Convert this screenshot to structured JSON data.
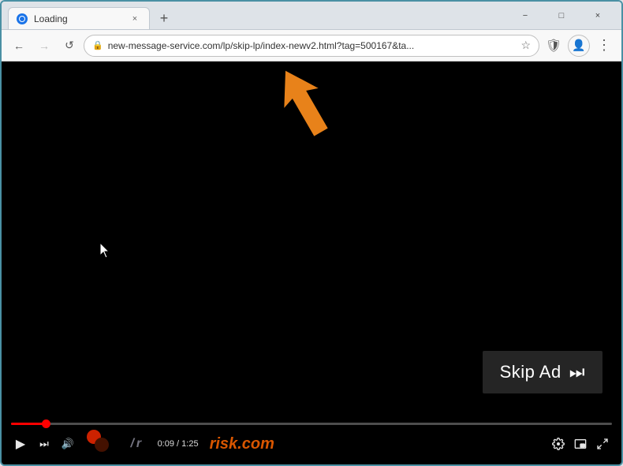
{
  "browser": {
    "tab": {
      "favicon_alt": "globe icon",
      "title": "Loading",
      "close_label": "×"
    },
    "new_tab_label": "+",
    "window_controls": {
      "minimize": "−",
      "maximize": "□",
      "close": "×"
    },
    "nav": {
      "back_label": "←",
      "forward_label": "→",
      "refresh_label": "↺",
      "address": "new-message-service.com/lp/skip-lp/index-newv2.html?tag=500167&ta...",
      "star_label": "☆",
      "shield_label": "🛡",
      "profile_label": "👤",
      "menu_label": "⋮"
    }
  },
  "video": {
    "skip_ad_label": "Skip Ad",
    "skip_ad_icon": "⏭",
    "progress_pct": 6,
    "time_current": "0:09",
    "time_total": "1:25",
    "controls": {
      "play": "▶",
      "next": "⏭",
      "volume": "🔊"
    },
    "watermark": "risk.com",
    "watermark_prefix": ""
  },
  "colors": {
    "accent_orange": "#E8821A",
    "skip_ad_bg": "rgba(40,40,40,0.92)",
    "progress_red": "#ff0000"
  }
}
